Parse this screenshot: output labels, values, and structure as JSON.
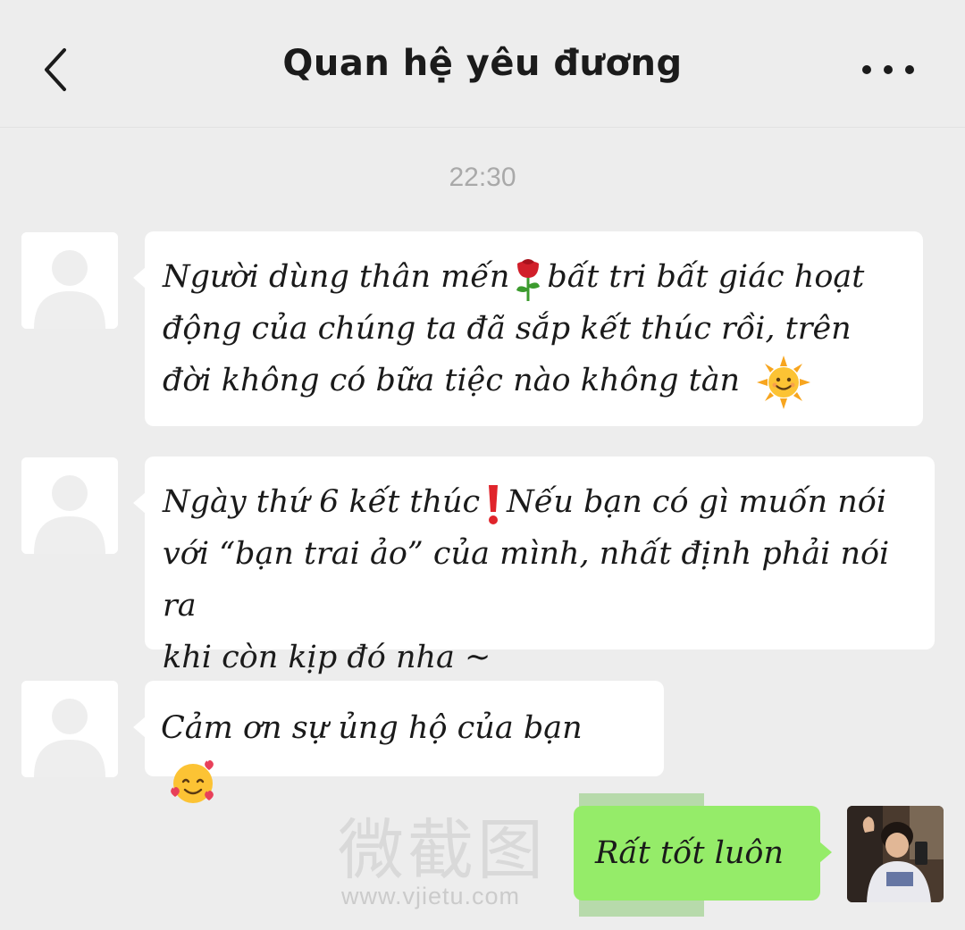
{
  "header": {
    "title": "Quan hệ yêu đương",
    "back_icon": "chevron-left-icon",
    "more_icon": "more-horizontal-icon"
  },
  "timestamp": "22:30",
  "messages": [
    {
      "sender": "other",
      "lines": [
        "Người dùng thân mến",
        "bất tri bất giác hoạt",
        "động của chúng ta đã sắp kết thúc rồi, trên",
        "đời không có bữa tiệc nào không tàn"
      ],
      "emoji": [
        "rose-emoji",
        "sun-face-emoji"
      ]
    },
    {
      "sender": "other",
      "lines": [
        "Ngày thứ 6 kết thúc",
        "Nếu bạn có gì muốn nói",
        "với “bạn trai ảo” của mình, nhất định phải nói ra",
        "khi còn kịp đó nha ~"
      ],
      "emoji": [
        "exclamation-emoji"
      ]
    },
    {
      "sender": "other",
      "lines": [
        "Cảm ơn sự ủng hộ của bạn"
      ],
      "emoji": [
        "smiling-face-with-hearts-emoji"
      ]
    },
    {
      "sender": "me",
      "lines": [
        "Rất tốt luôn"
      ]
    }
  ],
  "watermark": {
    "text": "微截图",
    "url": "www.vjietu.com"
  },
  "colors": {
    "background": "#ededed",
    "bubble_other": "#ffffff",
    "bubble_mine": "#95ec69",
    "timestamp": "#a9a9a9"
  }
}
